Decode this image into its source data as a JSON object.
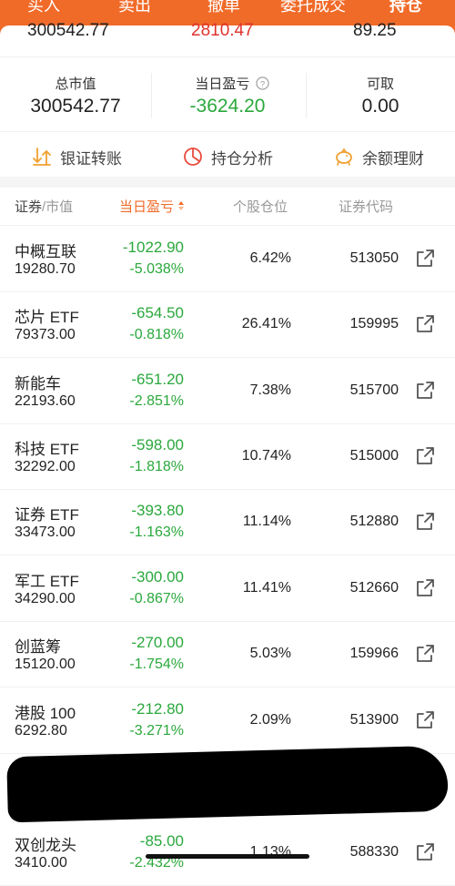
{
  "tabs": [
    "买入",
    "卖出",
    "撤单",
    "委托成交",
    "持仓"
  ],
  "overflow_values": [
    "300542.77",
    "2810.47",
    "89.25"
  ],
  "summary": {
    "market_value_label": "总市值",
    "market_value": "300542.77",
    "today_pl_label": "当日盈亏",
    "today_pl": "-3624.20",
    "available_label": "可取",
    "available": "0.00"
  },
  "actions": {
    "transfer": "银证转账",
    "analysis": "持仓分析",
    "wealth": "余额理财"
  },
  "table_header": {
    "security": "证券",
    "market_value": "/市值",
    "today_pl": "当日盈亏",
    "weight": "个股仓位",
    "code": "证券代码"
  },
  "rows": [
    {
      "name": "中概互联",
      "value": "19280.70",
      "pl": "-1022.90",
      "pct": "-5.038%",
      "weight": "6.42%",
      "code": "513050"
    },
    {
      "name": "芯片 ETF",
      "value": "79373.00",
      "pl": "-654.50",
      "pct": "-0.818%",
      "weight": "26.41%",
      "code": "159995"
    },
    {
      "name": "新能车",
      "value": "22193.60",
      "pl": "-651.20",
      "pct": "-2.851%",
      "weight": "7.38%",
      "code": "515700"
    },
    {
      "name": "科技 ETF",
      "value": "32292.00",
      "pl": "-598.00",
      "pct": "-1.818%",
      "weight": "10.74%",
      "code": "515000"
    },
    {
      "name": "证券 ETF",
      "value": "33473.00",
      "pl": "-393.80",
      "pct": "-1.163%",
      "weight": "11.14%",
      "code": "512880"
    },
    {
      "name": "军工 ETF",
      "value": "34290.00",
      "pl": "-300.00",
      "pct": "-0.867%",
      "weight": "11.41%",
      "code": "512660"
    },
    {
      "name": "创蓝筹",
      "value": "15120.00",
      "pl": "-270.00",
      "pct": "-1.754%",
      "weight": "5.03%",
      "code": "159966"
    },
    {
      "name": "港股 100",
      "value": "6292.80",
      "pl": "-212.80",
      "pct": "-3.271%",
      "weight": "2.09%",
      "code": "513900"
    },
    {
      "name": "双创龙头",
      "value": "3410.00",
      "pl": "-85.00",
      "pct": "-2.432%",
      "weight": "1.13%",
      "code": "588330"
    }
  ],
  "colors": {
    "brand": "#f06a28",
    "loss": "#2aa83c",
    "sort_arrow": "#f06a28"
  }
}
